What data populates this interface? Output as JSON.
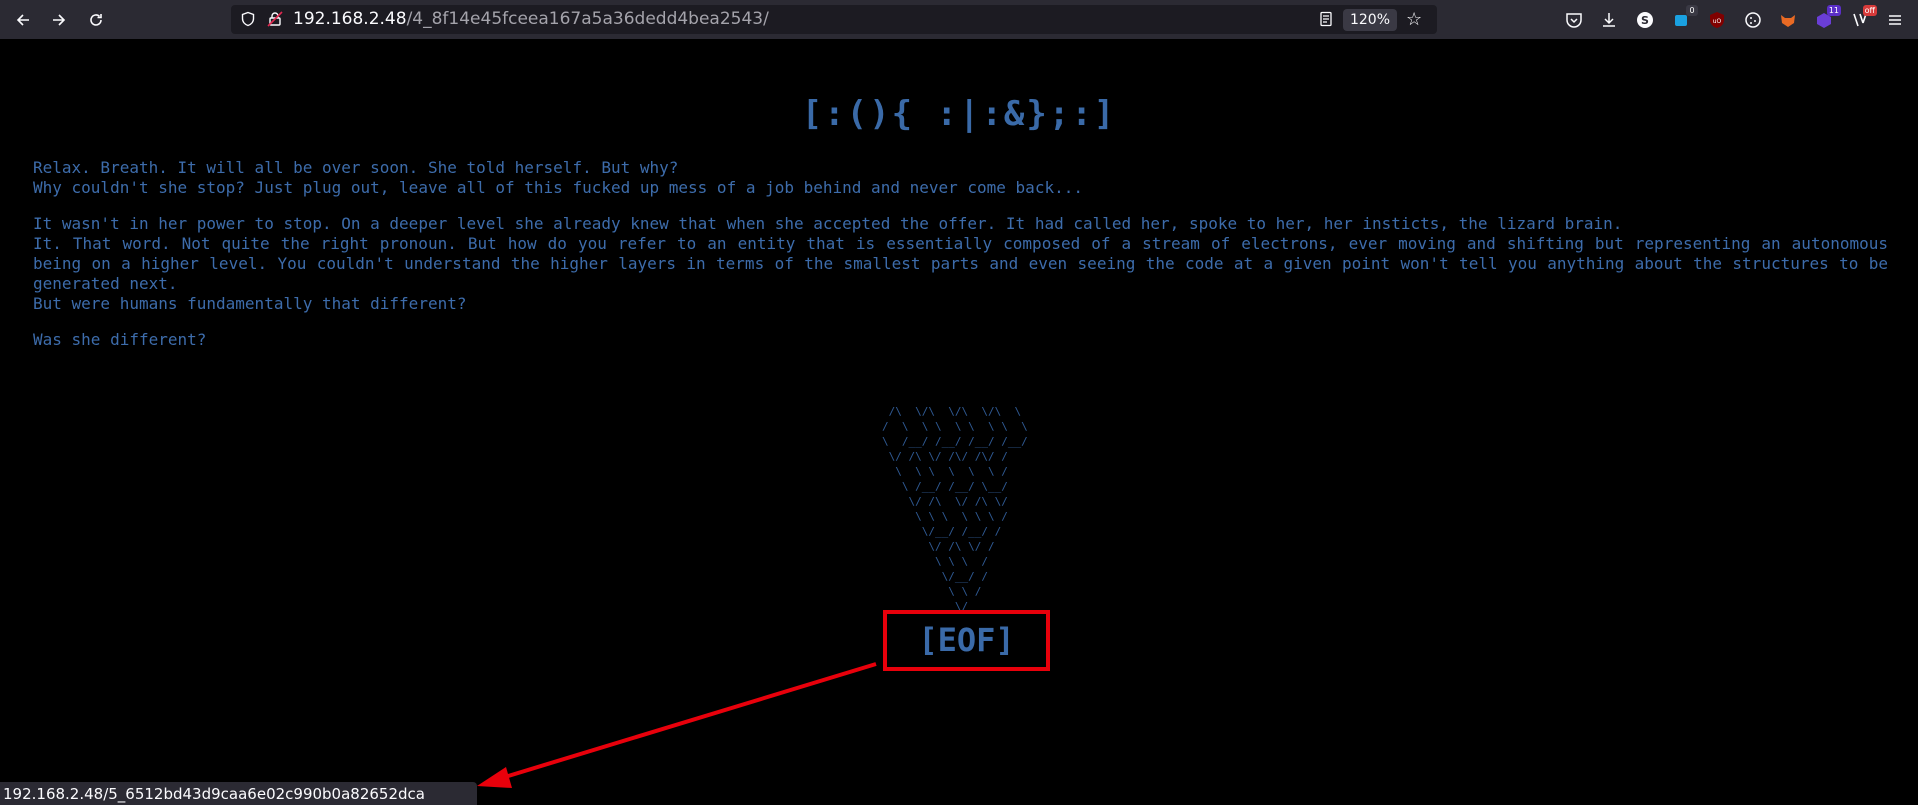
{
  "browser": {
    "url_host": "192.168.2.48",
    "url_path": "/4_8f14e45fceea167a5a36dedd4bea2543/",
    "zoom": "120%",
    "extension_badges": {
      "badge_a": "0",
      "badge_b": "11",
      "badge_c": "off"
    }
  },
  "page": {
    "title": "[:(){ :|:&};:]",
    "paragraph1": [
      "Relax. Breath. It will all be over soon. She told herself. But why?",
      "Why couldn't she stop? Just plug out, leave all of this fucked up mess of a job behind and never come back..."
    ],
    "paragraph2_line1": "It wasn't in her power to stop. On a deeper level she already knew that when she accepted the offer. It had called her, spoke to her, her insticts, the lizard brain.",
    "paragraph2_body": "It. That word. Not quite the right pronoun. But how do you refer to an entity that is essentially composed of a stream of electrons, ever moving and shifting but representing an autonomous being on a higher level. You couldn't understand the higher layers in terms of the smallest parts and even seeing the code at a given point won't tell you anything about the structures to be generated next.",
    "paragraph2_last": "But were humans fundamentally that different?",
    "paragraph3": "Was she different?",
    "ascii_art": " /\\  \\/\\  \\/\\  \\/\\  \\\n/  \\  \\ \\  \\ \\  \\ \\  \\\n\\  /__/ /__/ /__/ /__/\n \\/ /\\ \\/ /\\/ /\\/ /\n  \\  \\ \\  \\  \\  \\ /\n   \\ /__/ /__/ \\__/\n    \\/ /\\  \\/ /\\ \\/\n     \\ \\ \\  \\ \\ \\ /\n      \\/__/ /__/ /\n       \\/ /\\ \\/ /\n        \\ \\ \\  /\n         \\/__/ /\n          \\ \\ /\n           \\/",
    "eof_label": "[EOF]"
  },
  "status_bar": {
    "link_url": "192.168.2.48/5_6512bd43d9caa6e02c990b0a82652dca"
  },
  "colors": {
    "text": "#3d6cab",
    "annotation": "#e8000b",
    "background": "#000000"
  }
}
